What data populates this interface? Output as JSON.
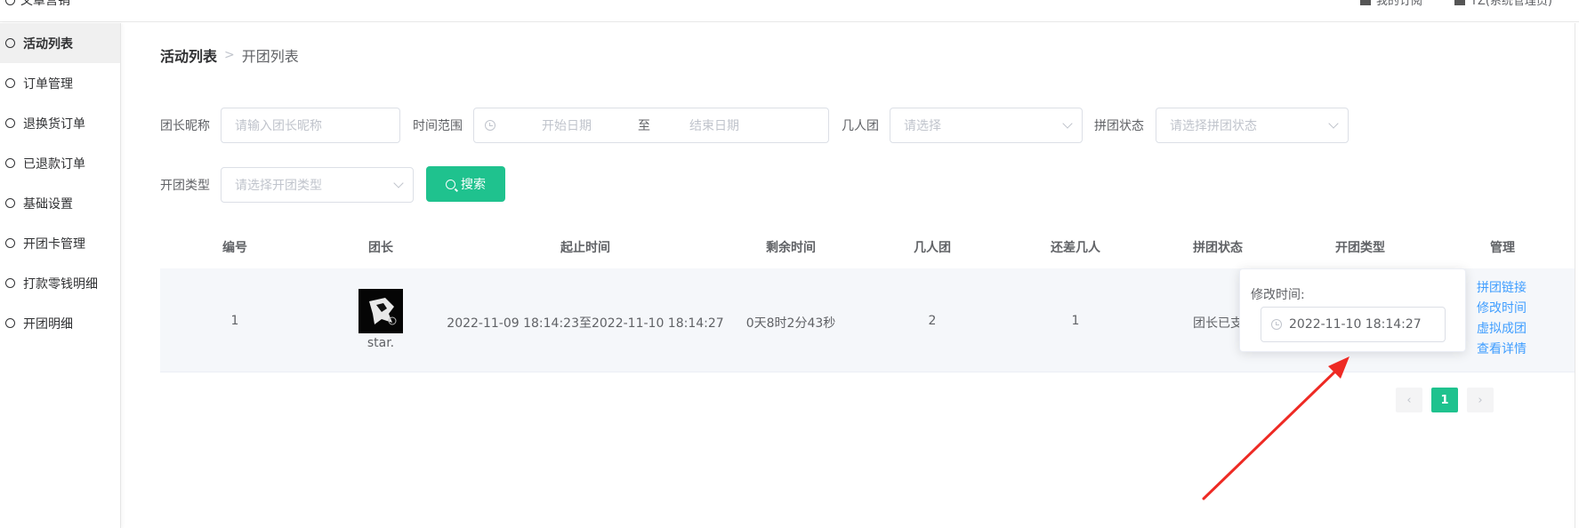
{
  "topbar": {
    "module_title": "文章营销",
    "right_items": [
      {
        "label": "我的订阅"
      },
      {
        "label": "YZ(系统管理员)"
      }
    ]
  },
  "sidebar": {
    "items": [
      {
        "label": "活动列表",
        "active": true
      },
      {
        "label": "订单管理"
      },
      {
        "label": "退换货订单"
      },
      {
        "label": "已退款订单"
      },
      {
        "label": "基础设置"
      },
      {
        "label": "开团卡管理"
      },
      {
        "label": "打款零钱明细"
      },
      {
        "label": "开团明细"
      }
    ]
  },
  "breadcrumb": {
    "parent": "活动列表",
    "current": "开团列表",
    "separator": ">"
  },
  "filters": {
    "leader_label": "团长昵称",
    "leader_placeholder": "请输入团长昵称",
    "time_label": "时间范围",
    "start_placeholder": "开始日期",
    "range_sep": "至",
    "end_placeholder": "结束日期",
    "size_label": "几人团",
    "size_placeholder": "请选择",
    "status_label": "拼团状态",
    "status_placeholder": "请选择拼团状态",
    "type_label": "开团类型",
    "type_placeholder": "请选择开团类型",
    "search_label": "搜索"
  },
  "table": {
    "headers": [
      "编号",
      "团长",
      "起止时间",
      "剩余时间",
      "几人团",
      "还差几人",
      "拼团状态",
      "开团类型",
      "管理"
    ],
    "rows": [
      {
        "id": "1",
        "leader": "star.",
        "period": "2022-11-09 18:14:23至2022-11-10 18:14:27",
        "remaining": "0天8时2分43秒",
        "size": "2",
        "missing": "1",
        "status": "团长已支",
        "actions": [
          "拼团链接",
          "修改时间",
          "虚拟成团",
          "查看详情"
        ]
      }
    ]
  },
  "popover": {
    "title": "修改时间:",
    "value": "2022-11-10 18:14:27"
  },
  "pagination": {
    "current": "1",
    "prev_icon": "chevron-left-icon",
    "next_icon": "chevron-right-icon"
  },
  "colors": {
    "accent": "#1fc28e",
    "link": "#409eff",
    "annotation": "#ee2a24"
  }
}
